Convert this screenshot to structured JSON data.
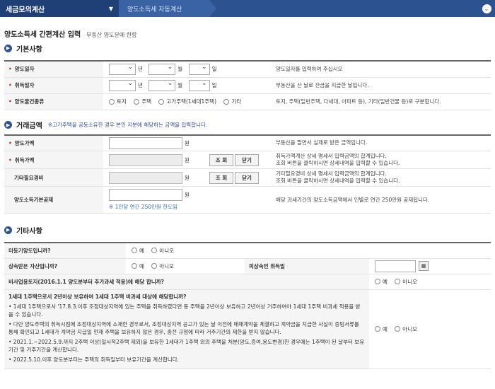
{
  "nav": {
    "menu_label": "세금모의계산",
    "current_page": "양도소득세 자동계산"
  },
  "page": {
    "title": "양도소득세 간편계산 입력",
    "subtitle": "부동산 양도분에 한함"
  },
  "basic": {
    "title": "기본사항",
    "transfer_date": {
      "label": "양도일자",
      "year_unit": "년",
      "month_unit": "월",
      "day_unit": "일",
      "desc": "양도일자를 입력하여 주십시오"
    },
    "acquire_date": {
      "label": "취득일자",
      "year_unit": "년",
      "month_unit": "월",
      "day_unit": "일",
      "desc": "부동산을 산 날로 잔금을 지급한 날입니다."
    },
    "property_type": {
      "label": "양도물건종류",
      "options": [
        "토지",
        "주택",
        "고가주택(1세대1주택)",
        "기타"
      ],
      "desc": "토지, 주택(일반주택, 다세대, 아파트 등), 기타(일반건물 등)로 구분합니다."
    }
  },
  "amount": {
    "title": "거래금액",
    "note": "※고가주택을 공동소유한 경우 본인 지분에 해당하는 금액을 입력합니다.",
    "transfer_price": {
      "label": "양도가액",
      "unit": "원",
      "desc": "부동산을 팔면서 실제로 받은 금액입니다."
    },
    "acquire_price": {
      "label": "취득가액",
      "unit": "원",
      "btn_lookup": "조 회",
      "btn_close": "닫기",
      "desc1": "취득가액계산 상세 명세서 입력금액의 합계입니다.",
      "desc2": "조회 버튼을 클릭하시면 상세내역을 입력할 수 있습니다."
    },
    "expenses": {
      "label": "기타필요경비",
      "unit": "원",
      "btn_lookup": "조 회",
      "btn_close": "닫기",
      "desc1": "기타필요경비 상세 명세서 입력금액의 합계입니다.",
      "desc2": "조회 버튼을 클릭하시면 상세내역을 입력할 수 있습니다."
    },
    "deduction": {
      "label": "양도소득기본공제",
      "unit": "원",
      "note": "※ 1인당 연간 250만원 한도임",
      "desc": "해당 과세기간의 양도소득금액에서 인별로 연간 250만원 공제됩니다."
    }
  },
  "other": {
    "title": "기타사항",
    "yes": "예",
    "no": "아니오",
    "unregistered": "미등기양도입니까?",
    "inherited": "상속받은 자산입니까?",
    "decedent_acq": "피상속인 취득일",
    "non_business_land": "비사업용토지(2016.1.1 양도분부터 추가과세 적용)에 해당 합니까?",
    "one_house": {
      "question": "1세대 1주택으로서 2년이상 보유하여 1세대 1주택 비과세 대상에 해당합니까?",
      "bullets": [
        "• 1세대 1주택으로서 '17.8.3.이후 조정대상지역에 있는 주택을 취득하였다면 동 주택을 2년이상 보유하고 2년이상 거주하여야 1세대 1주택 비과세 적용을 받을 수 있습니다.",
        "• 다만 양도주택의 취득시점에 조정대상지역에 소재한 경우로서, 조정대상지역 공고가 있는 날 이전에 매매계약을 체결하고 계약금을 지급한 사실이 증빙서류를 통해 확인되고 1세대가 계약금 지급일 현재 주택을 보유하지 않은 경우, 종전 규정에 따라 거주기간의 제한을 받지 않습니다.",
        "• 2021.1.~2022.5.9.까지 2주택 이상(일시적2주택 제외)을 보유한 1세대가 1주택 외의 주택을 처분(양도,증여,용도변경)한 경우에는 1주택이 된 날부터 보유기간 및 거주기간을 계산합니다.",
        "• 2022.5.10.이후 양도분부터는 주택의 취득일부터 보유기간을 계산합니다."
      ]
    }
  }
}
